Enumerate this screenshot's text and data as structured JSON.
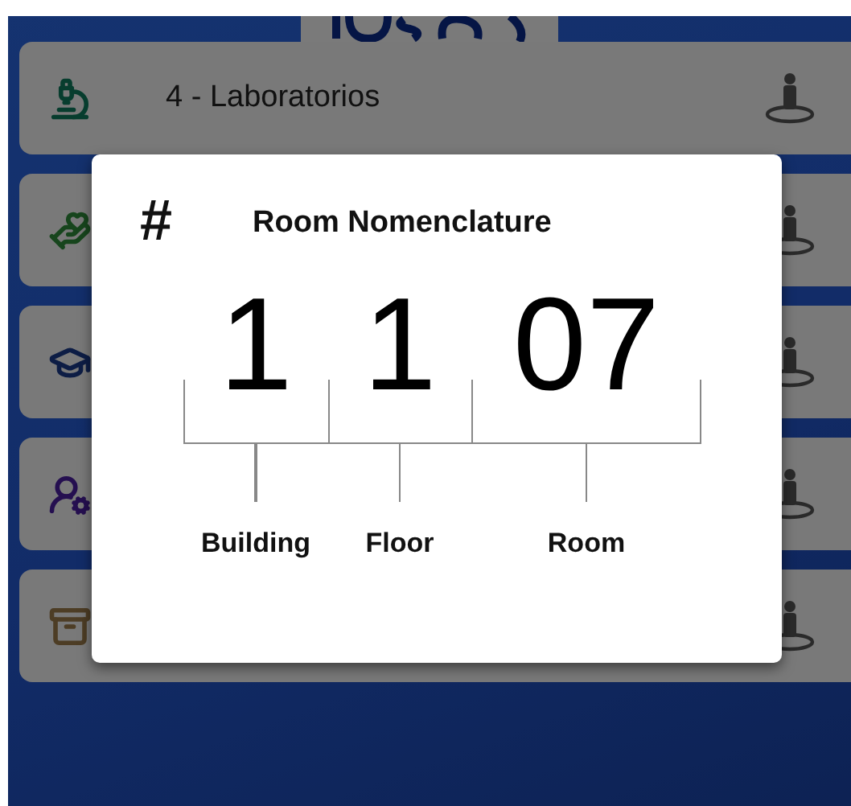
{
  "app": {
    "list_items": [
      {
        "kind": "lab",
        "label": "4 - Laboratorios"
      },
      {
        "kind": "care"
      },
      {
        "kind": "education"
      },
      {
        "kind": "people"
      },
      {
        "kind": "storage"
      }
    ]
  },
  "dialog": {
    "icon": "#",
    "title": "Room Nomenclature",
    "segments": [
      {
        "digits": "1",
        "label": "Building"
      },
      {
        "digits": "1",
        "label": "Floor"
      },
      {
        "digits": "07",
        "label": "Room"
      }
    ]
  }
}
